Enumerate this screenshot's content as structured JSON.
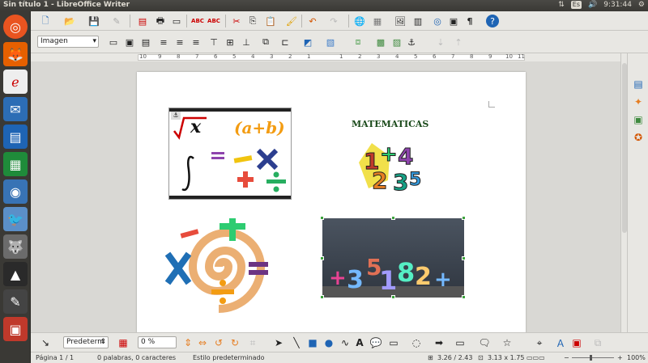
{
  "window": {
    "title": "Sin título 1 - LibreOffice Writer"
  },
  "tray": {
    "keyboard": "Es",
    "volume_icon": "volume-icon",
    "time": "9:31:44"
  },
  "formatting": {
    "style_value": "Imagen"
  },
  "ruler": {
    "numbers": [
      "10",
      "9",
      "8",
      "7",
      "6",
      "5",
      "4",
      "3",
      "2",
      "1",
      "1",
      "2",
      "3",
      "4",
      "5",
      "6",
      "7",
      "8",
      "9",
      "10",
      "11"
    ]
  },
  "document": {
    "matematicas_label": "MATEMATICAS",
    "formula_text": "(a+b)",
    "sqrt_var": "x",
    "numbers_image": [
      "+",
      "3",
      "5",
      "1",
      "8",
      "2",
      "+"
    ]
  },
  "drawbar": {
    "line_style": "Predeterm",
    "transparency": "0 %"
  },
  "status": {
    "page": "Página 1 / 1",
    "words": "0 palabras, 0 caracteres",
    "style": "Estilo predeterminado",
    "position": "3.26 / 2.43",
    "size": "3.13 x 1.75",
    "zoom": "100%"
  },
  "colors": {
    "accent": "#e95420",
    "selection": "#3ea33e",
    "orange": "#f39c12"
  }
}
